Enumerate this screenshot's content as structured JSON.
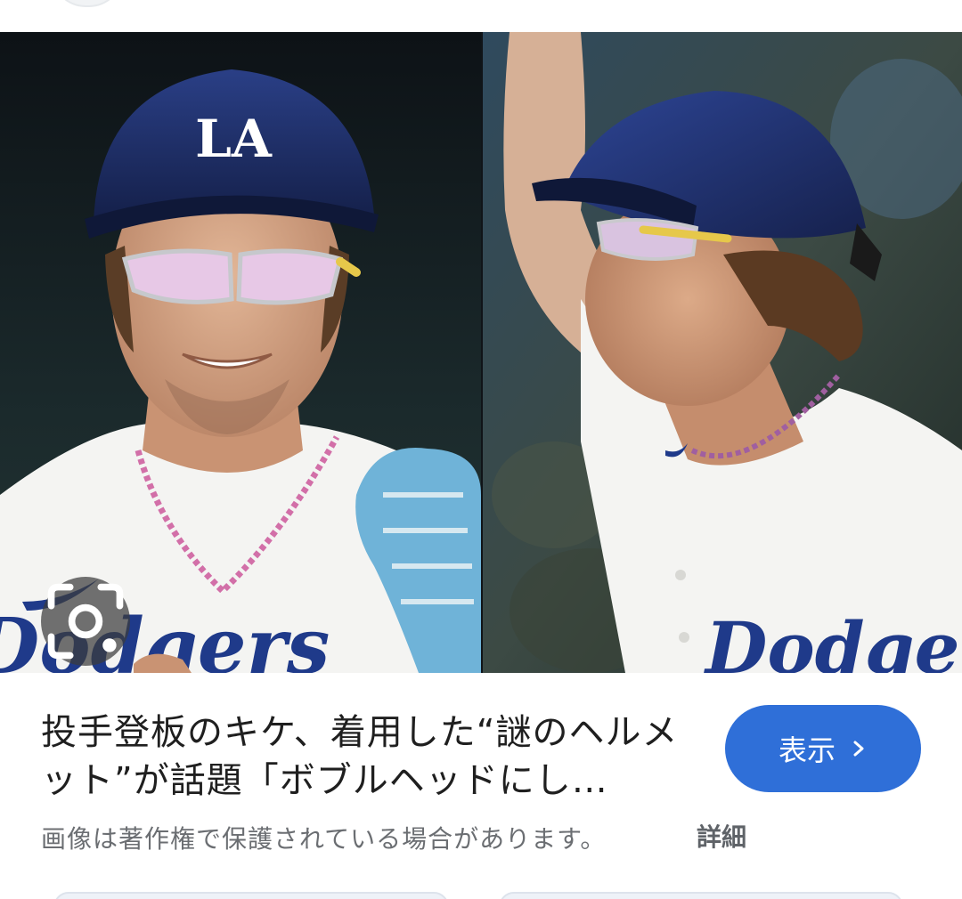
{
  "result": {
    "title": "投手登板のキケ、着用した“謎のヘルメット”が話題「ボブルヘッドにし…",
    "show_button_label": "表示",
    "copyright_notice": "画像は著作権で保護されている場合があります。",
    "details_label": "詳細"
  },
  "image": {
    "left_helmet_logo": "LA",
    "left_jersey_text": "Dodgers",
    "right_jersey_text": "Dodgers"
  },
  "icons": {
    "lens": "lens-camera-icon",
    "chevron": "chevron-right-icon"
  },
  "colors": {
    "accent_button": "#2f6fd8",
    "title_text": "#1f1f1f",
    "secondary_text": "#6b6e72",
    "helmet_blue": "#1c2d63",
    "jersey_white": "#f4f4f2",
    "glove_blue": "#6fb3d8"
  }
}
